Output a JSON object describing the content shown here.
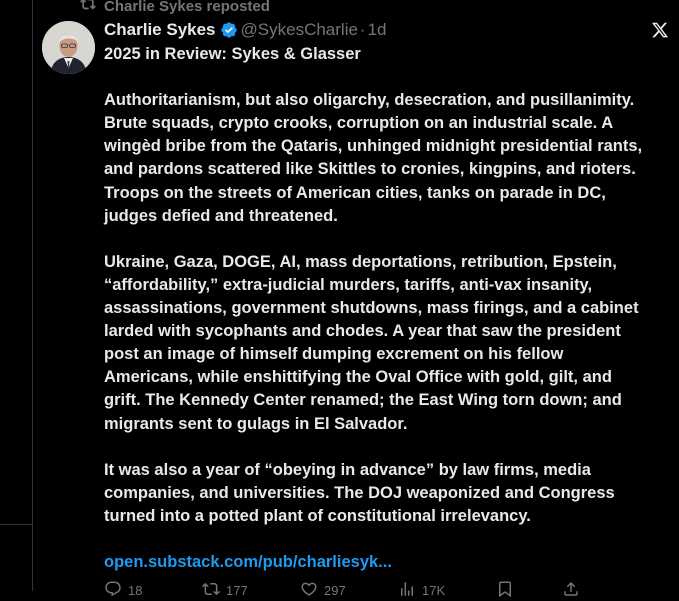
{
  "repost": {
    "text": "Charlie Sykes reposted"
  },
  "author": {
    "name": "Charlie Sykes",
    "handle": "@SykesCharlie",
    "separator": "·",
    "time": "1d"
  },
  "tweet": {
    "title": "2025 in Review: Sykes & Glasser",
    "lines": [
      "Authoritarianism, but also oligarchy, desecration, and pusillanimity.",
      "Brute squads, crypto crooks, corruption on an industrial scale. A",
      "wingèd bribe from the Qataris, unhinged midnight presidential rants,",
      "and pardons scattered like Skittles to cronies, kingpins, and rioters.",
      "Troops on the streets of American cities, tanks on parade in DC,",
      "judges defied and threatened.",
      "Ukraine, Gaza, DOGE, AI, mass deportations, retribution, Epstein,",
      "“affordability,” extra-judicial murders, tariffs, anti-vax insanity,",
      "assassinations, government shutdowns, mass firings, and a cabinet",
      "larded with sycophants and chodes. A year that saw the president",
      "post an image of himself dumping excrement on his fellow",
      "Americans, while enshittifying the Oval Office with gold, gilt, and",
      "grift. The Kennedy Center renamed; the East Wing torn down; and",
      "migrants sent to gulags in El Salvador.",
      "It was also a year of “obeying in advance” by law firms, media",
      "companies, and universities. The DOJ weaponized and Congress",
      "turned into a potted plant of constitutional irrelevancy."
    ],
    "link": "open.substack.com/pub/charliesyk..."
  },
  "actions": {
    "replies": "18",
    "reposts": "177",
    "likes": "297",
    "views": "17K"
  },
  "colors": {
    "background": "#000000",
    "text": "#e7e9ea",
    "muted": "#71767b",
    "link": "#1d9bf0",
    "verified": "#1d9bf0"
  }
}
